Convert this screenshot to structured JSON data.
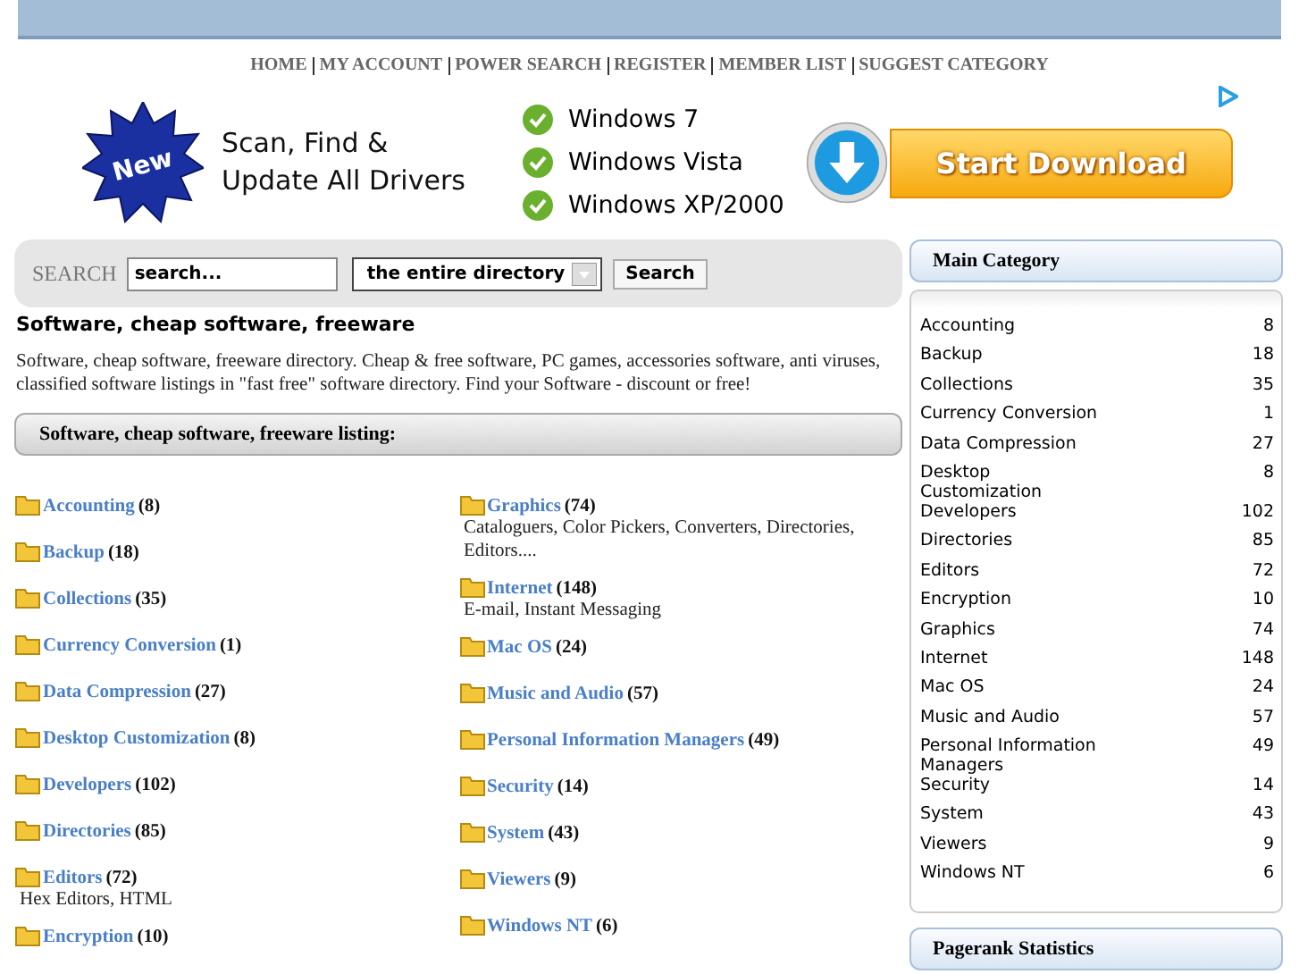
{
  "nav": [
    "HOME",
    "MY ACCOUNT",
    "POWER SEARCH",
    "REGISTER",
    "MEMBER LIST",
    "SUGGEST CATEGORY"
  ],
  "ad": {
    "badge": "New",
    "headline": "Scan, Find & Update All Drivers",
    "systems": [
      "Windows 7",
      "Windows Vista",
      "Windows XP/2000"
    ],
    "button": "Start Download"
  },
  "search": {
    "label": "SEARCH",
    "value": "search...",
    "scope": "the entire directory",
    "button": "Search"
  },
  "intro": {
    "title": "Software, cheap software, freeware",
    "text": "Software, cheap software, freeware directory. Cheap & free software, PC games, accessories software, anti viruses, classified software listings in \"fast free\" software directory. Find your Software - discount or free!"
  },
  "listing_title": "Software, cheap software, freeware listing:",
  "columns": [
    [
      {
        "name": "Accounting",
        "count": "(8)"
      },
      {
        "name": "Backup",
        "count": "(18)"
      },
      {
        "name": "Collections",
        "count": "(35)"
      },
      {
        "name": "Currency Conversion",
        "count": "(1)"
      },
      {
        "name": "Data Compression",
        "count": "(27)"
      },
      {
        "name": "Desktop Customization",
        "count": "(8)"
      },
      {
        "name": "Developers",
        "count": "(102)"
      },
      {
        "name": "Directories",
        "count": "(85)"
      },
      {
        "name": "Editors",
        "count": "(72)",
        "description": "Hex Editors, HTML"
      },
      {
        "name": "Encryption",
        "count": "(10)"
      }
    ],
    [
      {
        "name": "Graphics",
        "count": "(74)",
        "description": "Cataloguers, Color Pickers, Converters, Directories, Editors...."
      },
      {
        "name": "Internet",
        "count": "(148)",
        "description": "E-mail, Instant Messaging"
      },
      {
        "name": "Mac OS",
        "count": "(24)"
      },
      {
        "name": "Music and Audio",
        "count": "(57)"
      },
      {
        "name": "Personal Information Managers",
        "count": "(49)"
      },
      {
        "name": "Security",
        "count": "(14)"
      },
      {
        "name": "System",
        "count": "(43)"
      },
      {
        "name": "Viewers",
        "count": "(9)"
      },
      {
        "name": "Windows NT",
        "count": "(6)"
      }
    ]
  ],
  "sidebar": {
    "title": "Main Category",
    "items": [
      {
        "name": "Accounting",
        "count": "8"
      },
      {
        "name": "Backup",
        "count": "18"
      },
      {
        "name": "Collections",
        "count": "35"
      },
      {
        "name": "Currency Conversion",
        "count": "1"
      },
      {
        "name": "Data Compression",
        "count": "27"
      },
      {
        "name": "Desktop Customization",
        "count": "8"
      },
      {
        "name": "Developers",
        "count": "102"
      },
      {
        "name": "Directories",
        "count": "85"
      },
      {
        "name": "Editors",
        "count": "72"
      },
      {
        "name": "Encryption",
        "count": "10"
      },
      {
        "name": "Graphics",
        "count": "74"
      },
      {
        "name": "Internet",
        "count": "148"
      },
      {
        "name": "Mac OS",
        "count": "24"
      },
      {
        "name": "Music and Audio",
        "count": "57"
      },
      {
        "name": "Personal Information Managers",
        "count": "49"
      },
      {
        "name": "Security",
        "count": "14"
      },
      {
        "name": "System",
        "count": "43"
      },
      {
        "name": "Viewers",
        "count": "9"
      },
      {
        "name": "Windows NT",
        "count": "6"
      }
    ]
  },
  "sidebar_panel_2": {
    "title": "Pagerank Statistics"
  }
}
